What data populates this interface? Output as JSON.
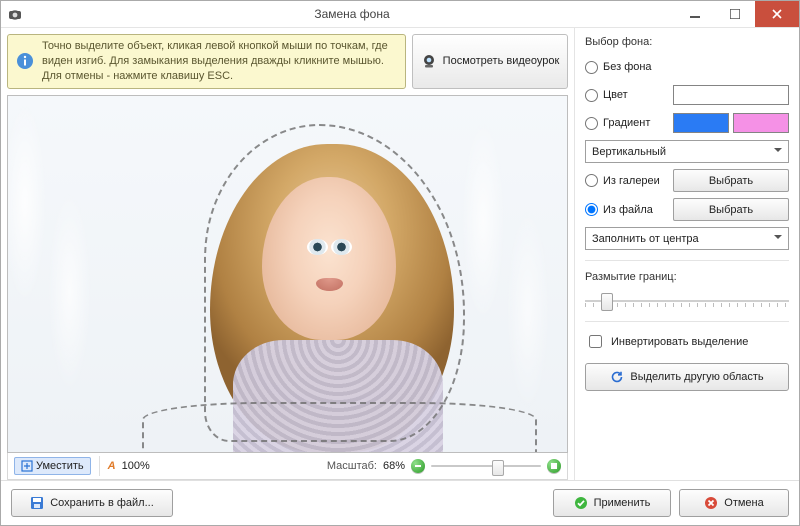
{
  "window": {
    "title": "Замена фона"
  },
  "hint": {
    "text": "Точно выделите объект, кликая левой кнопкой мыши по точкам, где виден изгиб. Для замыкания выделения дважды кликните мышью. Для отмены - нажмите клавишу ESC.",
    "video_button": "Посмотреть видеоурок"
  },
  "toolbar": {
    "fit": "Уместить",
    "auto_zoom_prefix": "A",
    "auto_zoom_value": "100%",
    "scale_label": "Масштаб:",
    "scale_value": "68%",
    "slider_position_pct": 55
  },
  "panel": {
    "title": "Выбор фона:",
    "options": {
      "no_bg": "Без фона",
      "color": "Цвет",
      "gradient": "Градиент",
      "from_gallery": "Из галереи",
      "from_file": "Из файла"
    },
    "selected": "from_file",
    "color_swatch": "#ffffff",
    "gradient_swatches": [
      "#2a7bf4",
      "#f591e6"
    ],
    "gradient_type_options": [
      "Вертикальный"
    ],
    "gradient_type_value": "Вертикальный",
    "choose_button": "Выбрать",
    "fill_mode_options": [
      "Заполнить от центра"
    ],
    "fill_mode_value": "Заполнить от центра",
    "blur_label": "Размытие границ:",
    "blur_position_pct": 8,
    "invert_label": "Инвертировать выделение",
    "invert_checked": false,
    "select_other_button": "Выделить другую область"
  },
  "footer": {
    "save": "Сохранить в файл...",
    "apply": "Применить",
    "cancel": "Отмена"
  },
  "icons": {
    "app": "camera-icon",
    "info": "info-icon",
    "webcam": "webcam-icon",
    "fit": "fit-screen-icon",
    "auto": "auto-icon",
    "minus": "zoom-out-icon",
    "plus": "zoom-in-icon",
    "refresh": "refresh-icon",
    "save": "floppy-icon",
    "ok": "check-circle-icon",
    "cancel": "cancel-circle-icon"
  }
}
